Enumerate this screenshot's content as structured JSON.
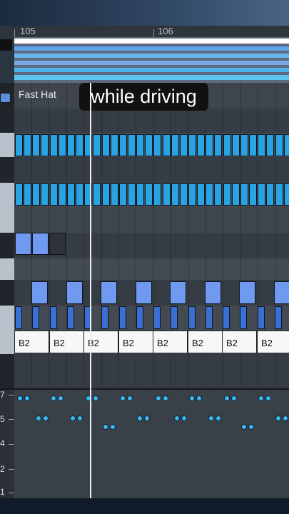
{
  "ruler": {
    "bar_105": "105",
    "bar_106": "106"
  },
  "clip": {
    "name": "Fast Hat"
  },
  "caption": {
    "text": "while driving"
  },
  "note_label": "B2",
  "velocity_scale": [
    "7",
    "5",
    "4",
    "2",
    "1"
  ],
  "colors": {
    "note_blue": "#2aa3e2",
    "note_periwinkle": "#6f9af0",
    "note_dark_blue": "#3a6fd4",
    "note_white": "#f6f7f9",
    "velocity_dot": "#3fb6ef"
  }
}
